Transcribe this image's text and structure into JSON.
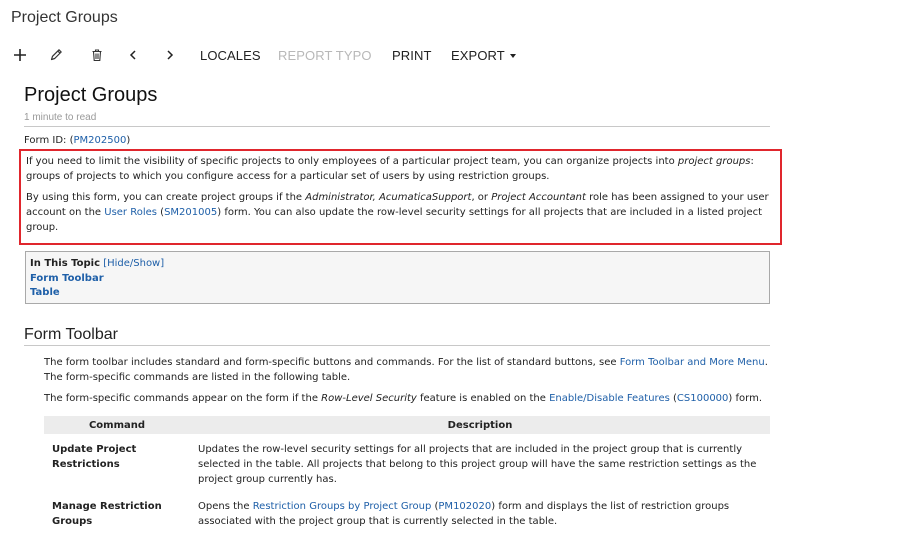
{
  "window": {
    "title": "Project Groups"
  },
  "toolbar": {
    "icons": [
      "plus-icon",
      "pencil-icon",
      "trash-icon",
      "chevron-left-icon",
      "chevron-right-icon"
    ],
    "locales": "LOCALES",
    "report_typo": "REPORT TYPO",
    "print": "PRINT",
    "export": "EXPORT"
  },
  "doc": {
    "title": "Project Groups",
    "read_time": "1 minute to read",
    "form_id_label": "Form ID: (",
    "form_id": "PM202500",
    "form_id_close": ")",
    "intro1_a": "If you need to limit the visibility of specific projects to only employees of a particular project team, you can organize projects into ",
    "intro1_em": "project groups",
    "intro1_b": ": groups of projects to which you configure access for a particular set of users by using restriction groups.",
    "intro2_a": "By using this form, you can create project groups if the ",
    "intro2_em1": "Administrator, AcumaticaSupport",
    "intro2_b": ", or ",
    "intro2_em2": "Project Accountant",
    "intro2_c": " role has been assigned to your user account on the ",
    "intro2_link1": "User Roles",
    "intro2_d": " (",
    "intro2_link2": "SM201005",
    "intro2_e": ") form. You can also update the row-level security settings for all projects that are included in a listed project group.",
    "topic": {
      "heading": "In This Topic",
      "toggle": "[Hide/Show]",
      "links": [
        "Form Toolbar",
        "Table"
      ]
    }
  },
  "section": {
    "title": "Form Toolbar",
    "p1_a": "The form toolbar includes standard and form-specific buttons and commands. For the list of standard buttons, see ",
    "p1_link": "Form Toolbar and More Menu",
    "p1_b": ". The form-specific commands are listed in the following table.",
    "p2_a": "The form-specific commands appear on the form if the ",
    "p2_em": "Row-Level Security",
    "p2_b": " feature is enabled on the ",
    "p2_link1": "Enable/Disable Features",
    "p2_c": " (",
    "p2_link2": "CS100000",
    "p2_d": ") form."
  },
  "table": {
    "headers": [
      "Command",
      "Description"
    ],
    "rows": [
      {
        "command": "Update Project Restrictions",
        "desc_a": "Updates the row-level security settings for all projects that are included in the project group that is currently selected in the table. All projects that belong to this project group will have the same restriction settings as the project group currently has."
      },
      {
        "command": "Manage Restriction Groups",
        "desc_a": "Opens the ",
        "desc_link1": "Restriction Groups by Project Group",
        "desc_b": " (",
        "desc_link2": "PM102020",
        "desc_c": ") form and displays the list of restriction groups associated with the project group that is currently selected in the table."
      }
    ]
  }
}
